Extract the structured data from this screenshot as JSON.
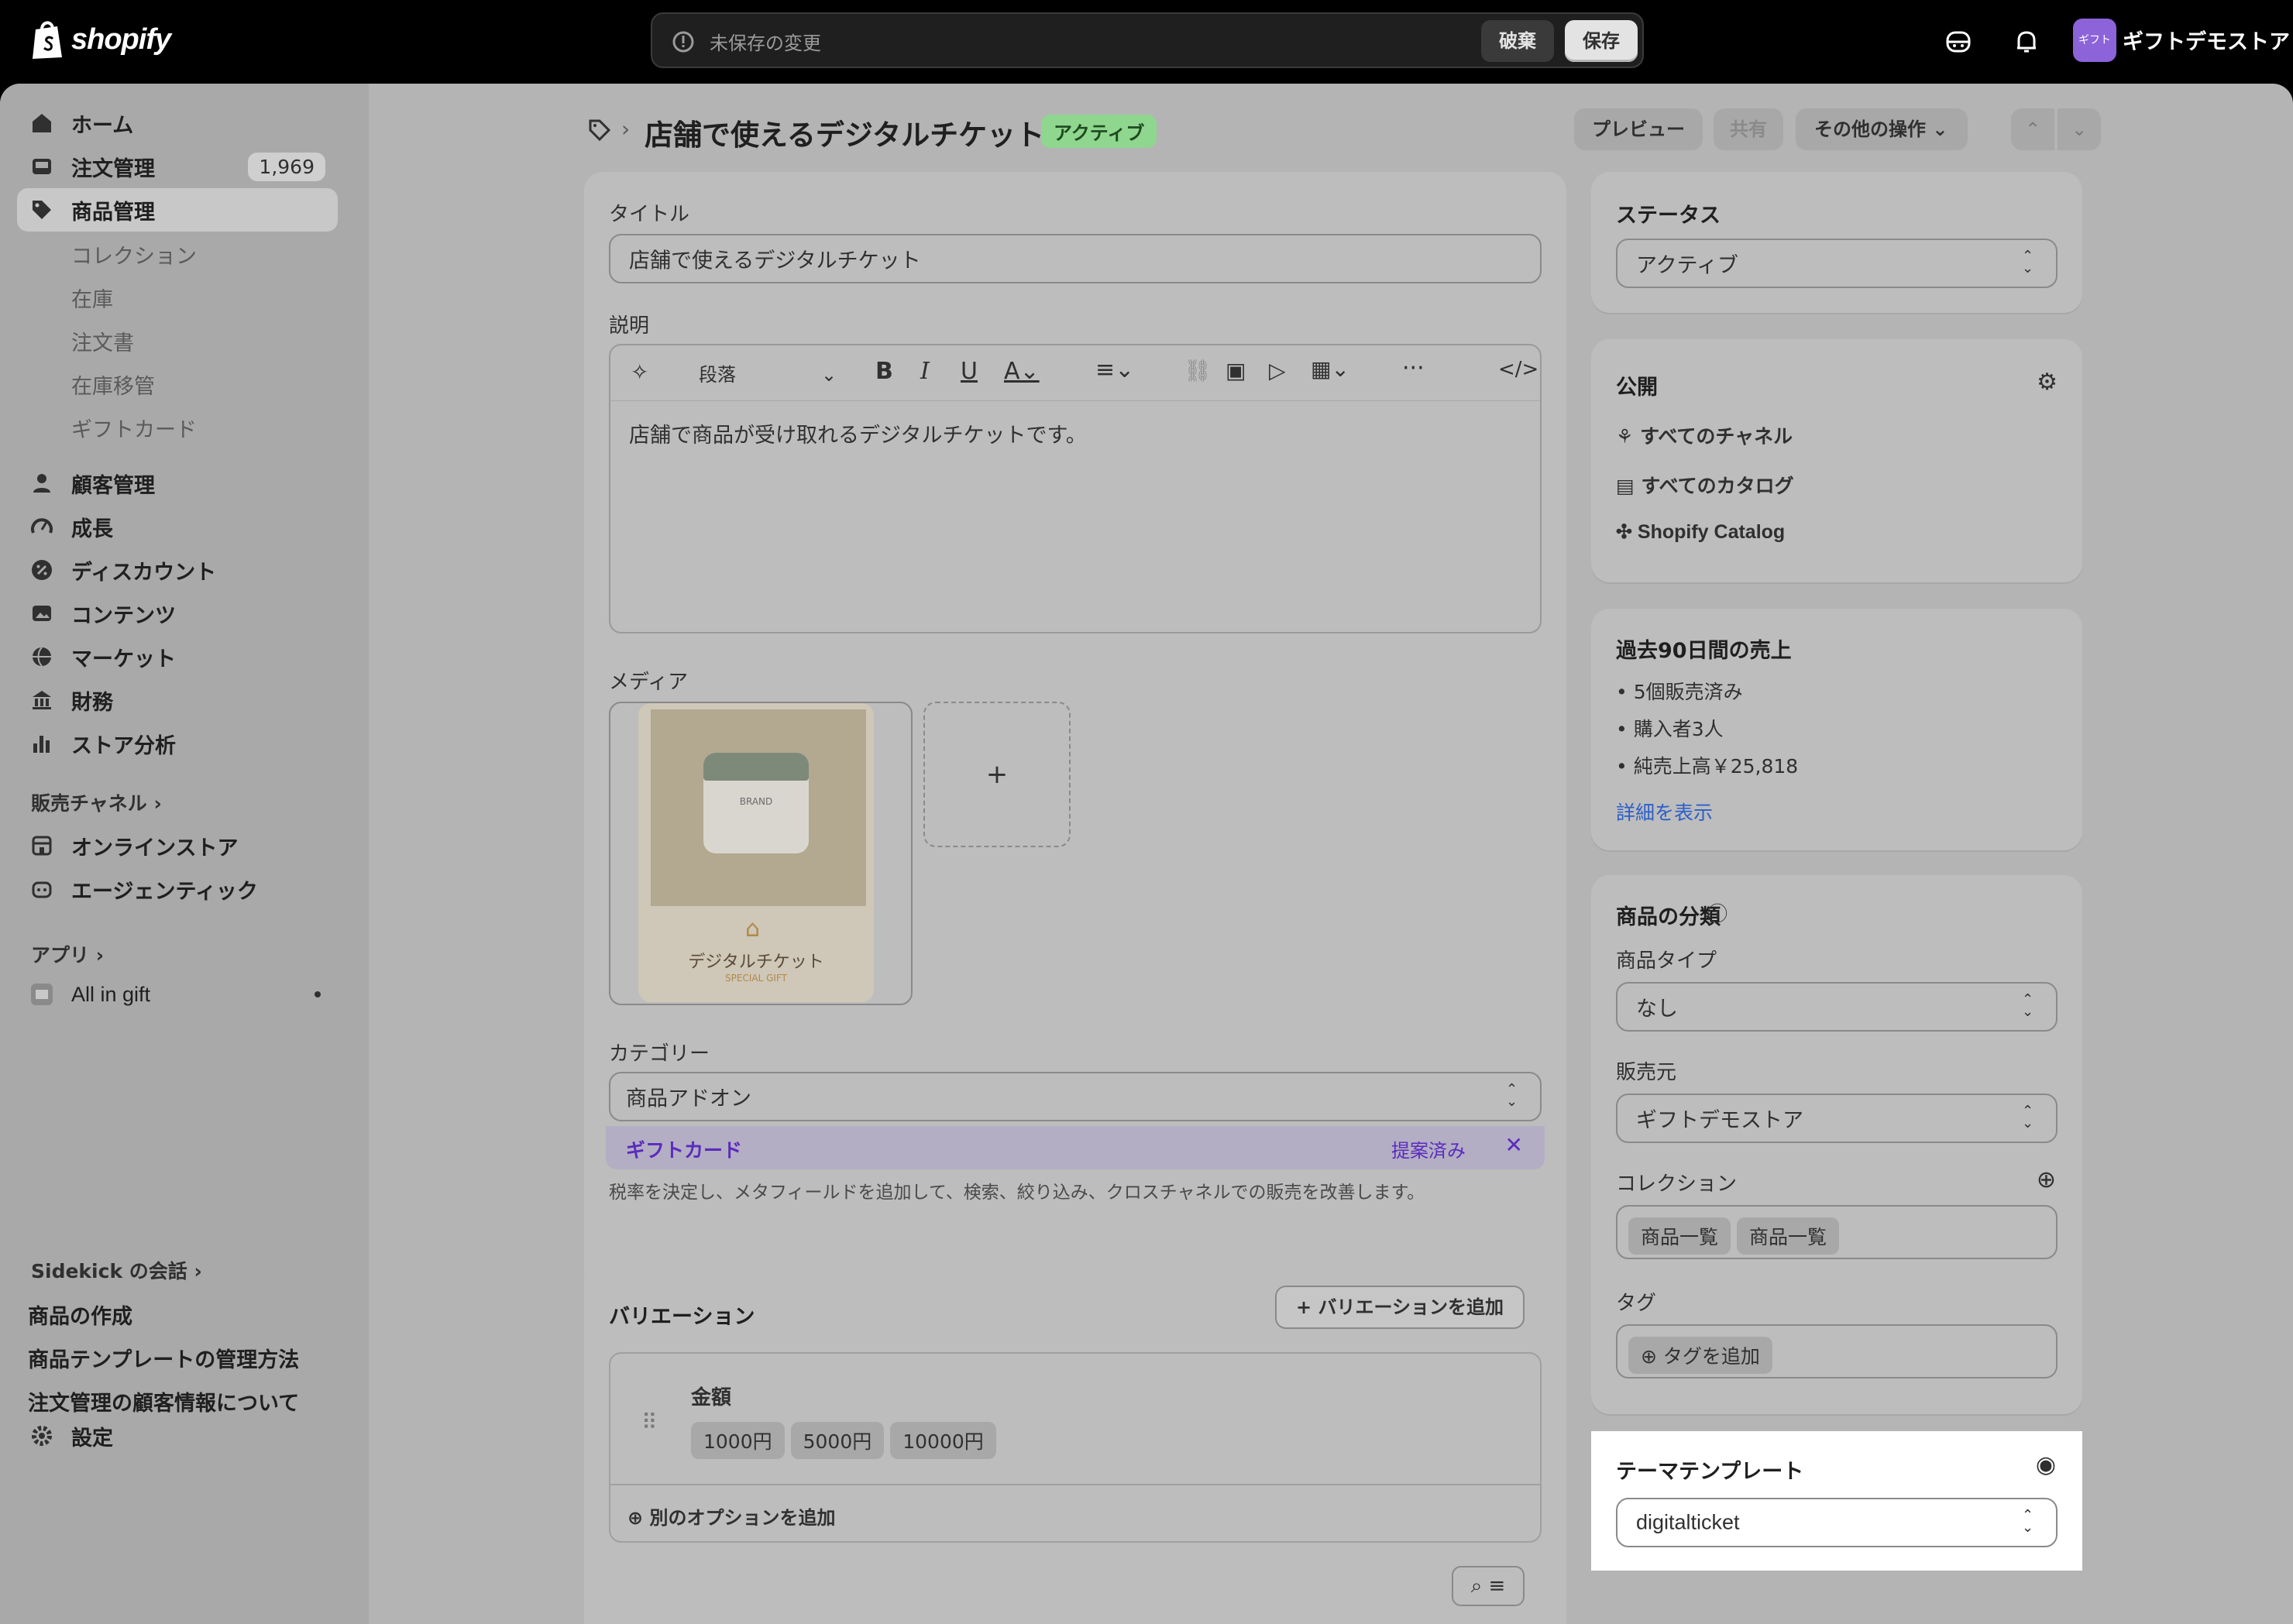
{
  "app": {
    "brand": "shopify"
  },
  "topbar": {
    "unsaved_text": "未保存の変更",
    "discard_label": "破棄",
    "save_label": "保存",
    "store_avatar_text": "ギフト",
    "store_name": "ギフトデモストア"
  },
  "sidebar": {
    "items": [
      {
        "label": "ホーム",
        "icon": "home-icon"
      },
      {
        "label": "注文管理",
        "icon": "inbox-icon",
        "badge": "1,969"
      },
      {
        "label": "商品管理",
        "icon": "tag-icon",
        "selected": true
      },
      {
        "label": "顧客管理",
        "icon": "person-icon"
      },
      {
        "label": "成長",
        "icon": "gauge-icon"
      },
      {
        "label": "ディスカウント",
        "icon": "discount-icon"
      },
      {
        "label": "コンテンツ",
        "icon": "image-icon"
      },
      {
        "label": "マーケット",
        "icon": "globe-icon"
      },
      {
        "label": "財務",
        "icon": "bank-icon"
      },
      {
        "label": "ストア分析",
        "icon": "bar-chart-icon"
      }
    ],
    "sub_items": [
      "コレクション",
      "在庫",
      "注文書",
      "在庫移管",
      "ギフトカード"
    ],
    "sales_channels_label": "販売チャネル",
    "channels": [
      {
        "label": "オンラインストア",
        "icon": "store-icon"
      },
      {
        "label": "エージェンティック",
        "icon": "robot-icon"
      }
    ],
    "apps_label": "アプリ",
    "apps": [
      {
        "label": "All in gift",
        "icon": "app-icon"
      }
    ],
    "sidekick_label": "Sidekick の会話",
    "help_links": [
      "商品の作成",
      "商品テンプレートの管理方法",
      "注文管理の顧客情報について"
    ],
    "settings_label": "設定"
  },
  "page": {
    "title": "店舗で使えるデジタルチケット",
    "status_badge": "アクティブ",
    "preview_label": "プレビュー",
    "share_label": "共有",
    "more_actions_label": "その他の操作"
  },
  "product": {
    "title_label": "タイトル",
    "title_value": "店舗で使えるデジタルチケット",
    "description_label": "説明",
    "paragraph_label": "段落",
    "description_text": "店舗で商品が受け取れるデジタルチケットです。",
    "media_label": "メディア",
    "media_add_symbol": "+",
    "media_image": {
      "brand_text": "BRAND",
      "ticket_title": "デジタルチケット",
      "ticket_sub": "SPECIAL GIFT"
    },
    "category_label": "カテゴリー",
    "category_value": "商品アドオン",
    "category_suggestion": "ギフトカード",
    "category_suggested_label": "提案済み",
    "category_help": "税率を決定し、メタフィールドを追加して、検索、絞り込み、クロスチャネルでの販売を改善します。"
  },
  "variants": {
    "heading": "バリエーション",
    "add_button": "バリエーションを追加",
    "option_name": "金額",
    "values": [
      "1000円",
      "5000円",
      "10000円"
    ],
    "add_option_label": "別のオプションを追加"
  },
  "status_card": {
    "heading": "ステータス",
    "value": "アクティブ"
  },
  "publishing": {
    "heading": "公開",
    "items": [
      {
        "label": "すべてのチャネル",
        "icon": "channels-icon"
      },
      {
        "label": "すべてのカタログ",
        "icon": "catalog-icon"
      },
      {
        "label": "Shopify Catalog",
        "icon": "catalog-network-icon"
      }
    ]
  },
  "sales": {
    "heading": "過去90日間の売上",
    "items": [
      "5個販売済み",
      "購入者3人",
      "純売上高￥25,818"
    ],
    "details_link": "詳細を表示"
  },
  "organization": {
    "heading": "商品の分類",
    "type_label": "商品タイプ",
    "type_value": "なし",
    "vendor_label": "販売元",
    "vendor_value": "ギフトデモストア",
    "collections_label": "コレクション",
    "collections": [
      "商品一覧",
      "商品一覧"
    ],
    "tags_label": "タグ",
    "add_tag_label": "タグを追加"
  },
  "theme_template": {
    "heading": "テーマテンプレート",
    "value": "digitalticket"
  },
  "colors": {
    "top_bg": "#000000",
    "overlay_bg": "#b4b4b4",
    "active_badge": "#8fd68f",
    "link": "#2c5fc9",
    "suggest": "#5b2bbd"
  }
}
